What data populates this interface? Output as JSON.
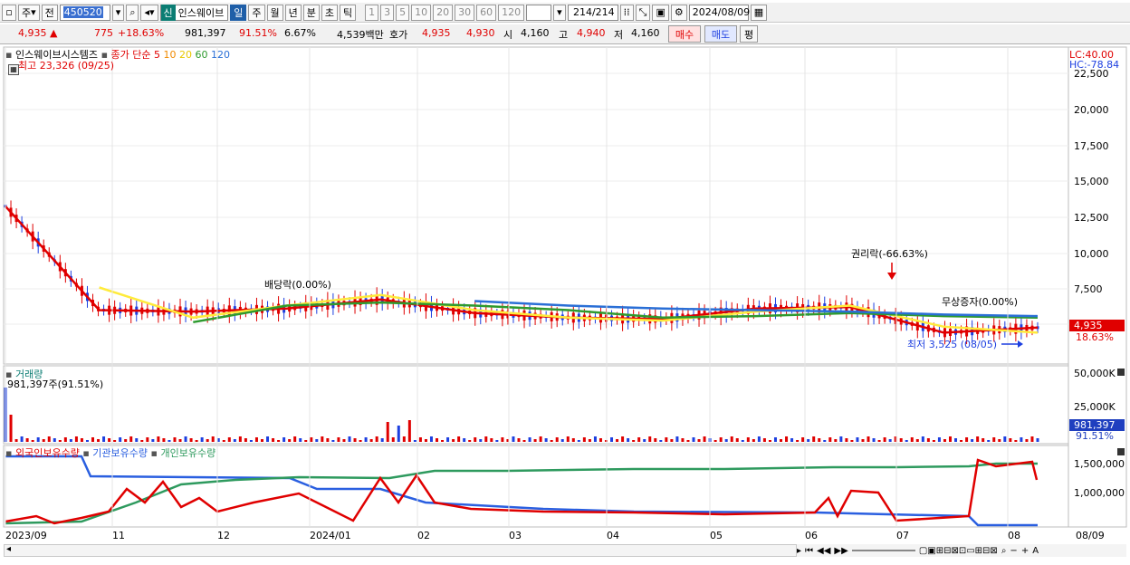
{
  "toolbar": {
    "period_label": "주",
    "prev_label": "전",
    "stock_code": "450520",
    "new_badge": "신",
    "stock_name": "인스웨이브",
    "intervals": [
      "일",
      "주",
      "월",
      "년",
      "분",
      "초",
      "틱"
    ],
    "selected_interval": "일",
    "numbers": [
      "1",
      "3",
      "5",
      "10",
      "20",
      "30",
      "60",
      "120"
    ],
    "count": "214",
    "total": "/214",
    "date": "2024/08/09"
  },
  "quote": {
    "price": "4,935",
    "change": "775",
    "change_pct": "+18.63%",
    "volume": "981,397",
    "volume_pct": "91.51%",
    "turnover": "6.67%",
    "amount": "4,539백만",
    "ask_label": "호가",
    "ask": "4,935",
    "bid": "4,930",
    "open_label": "시",
    "open": "4,160",
    "high_label": "고",
    "high": "4,940",
    "low_label": "저",
    "low": "4,160",
    "buy_label": "매수",
    "sell_label": "매도",
    "eval_label": "평"
  },
  "price_panel": {
    "legend_name": "인스웨이브시스템즈",
    "legend_ma": "종가 단순",
    "ma_periods": [
      "5",
      "10",
      "20",
      "60",
      "120"
    ],
    "ma_colors": [
      "#e00000",
      "#f08a00",
      "#ffeb3b",
      "#2e9a2e",
      "#2a6fd6"
    ],
    "high_note": "최고 23,326 (09/25)",
    "low_note": "최저 3,525 (08/05)",
    "event_dividend": "배당락(0.00%)",
    "event_rights": "권리락(-66.63%)",
    "event_bonus": "무상증자(0.00%)",
    "lc": "LC:40.00",
    "hc": "HC:-78.84",
    "yticks": [
      "22,500",
      "20,000",
      "17,500",
      "15,000",
      "12,500",
      "10,000",
      "7,500"
    ],
    "current_price": "4,935",
    "current_pct": "18.63%"
  },
  "volume_panel": {
    "legend": "거래량",
    "note": "981,397주(91.51%)",
    "yticks": [
      "50,000K",
      "25,000K"
    ],
    "current": "981,397",
    "current_pct": "91.51%"
  },
  "holding_panel": {
    "legend_foreign": "외국인보유수량",
    "legend_inst": "기관보유수량",
    "legend_indiv": "개인보유수량",
    "yticks": [
      "1,500,000",
      "1,000,000"
    ],
    "colors": [
      "#e00000",
      "#2a5fe0",
      "#2e9a5e"
    ]
  },
  "xaxis": {
    "labels": [
      "2023/09",
      "11",
      "12",
      "2024/01",
      "02",
      "03",
      "04",
      "05",
      "06",
      "07",
      "08"
    ],
    "right_label": "08/09"
  },
  "chart_data": {
    "type": "line",
    "title": "인스웨이브시스템즈",
    "x": [
      "2023/09",
      "11",
      "12",
      "2024/01",
      "02",
      "03",
      "04",
      "05",
      "06",
      "07",
      "08",
      "08/09"
    ],
    "series": [
      {
        "name": "종가 단순 5",
        "values": [
          13000,
          6100,
          6000,
          6200,
          6800,
          5900,
          5600,
          5500,
          6200,
          6300,
          4600,
          4935
        ]
      },
      {
        "name": "20",
        "values": [
          null,
          7600,
          5600,
          6400,
          7100,
          6100,
          5600,
          5400,
          6000,
          6400,
          5000,
          4600
        ]
      },
      {
        "name": "60",
        "values": [
          null,
          null,
          5300,
          6400,
          6600,
          6400,
          6100,
          5600,
          5700,
          5900,
          5700,
          5600
        ]
      },
      {
        "name": "120",
        "values": [
          null,
          null,
          null,
          null,
          null,
          6700,
          6400,
          6200,
          6100,
          6000,
          5800,
          5700
        ]
      }
    ],
    "annotations": [
      "최고 23,326 (09/25)",
      "최저 3,525 (08/05)",
      "배당락(0.00%)",
      "권리락(-66.63%)",
      "무상증자(0.00%)"
    ],
    "ylim": [
      3000,
      23000
    ]
  }
}
